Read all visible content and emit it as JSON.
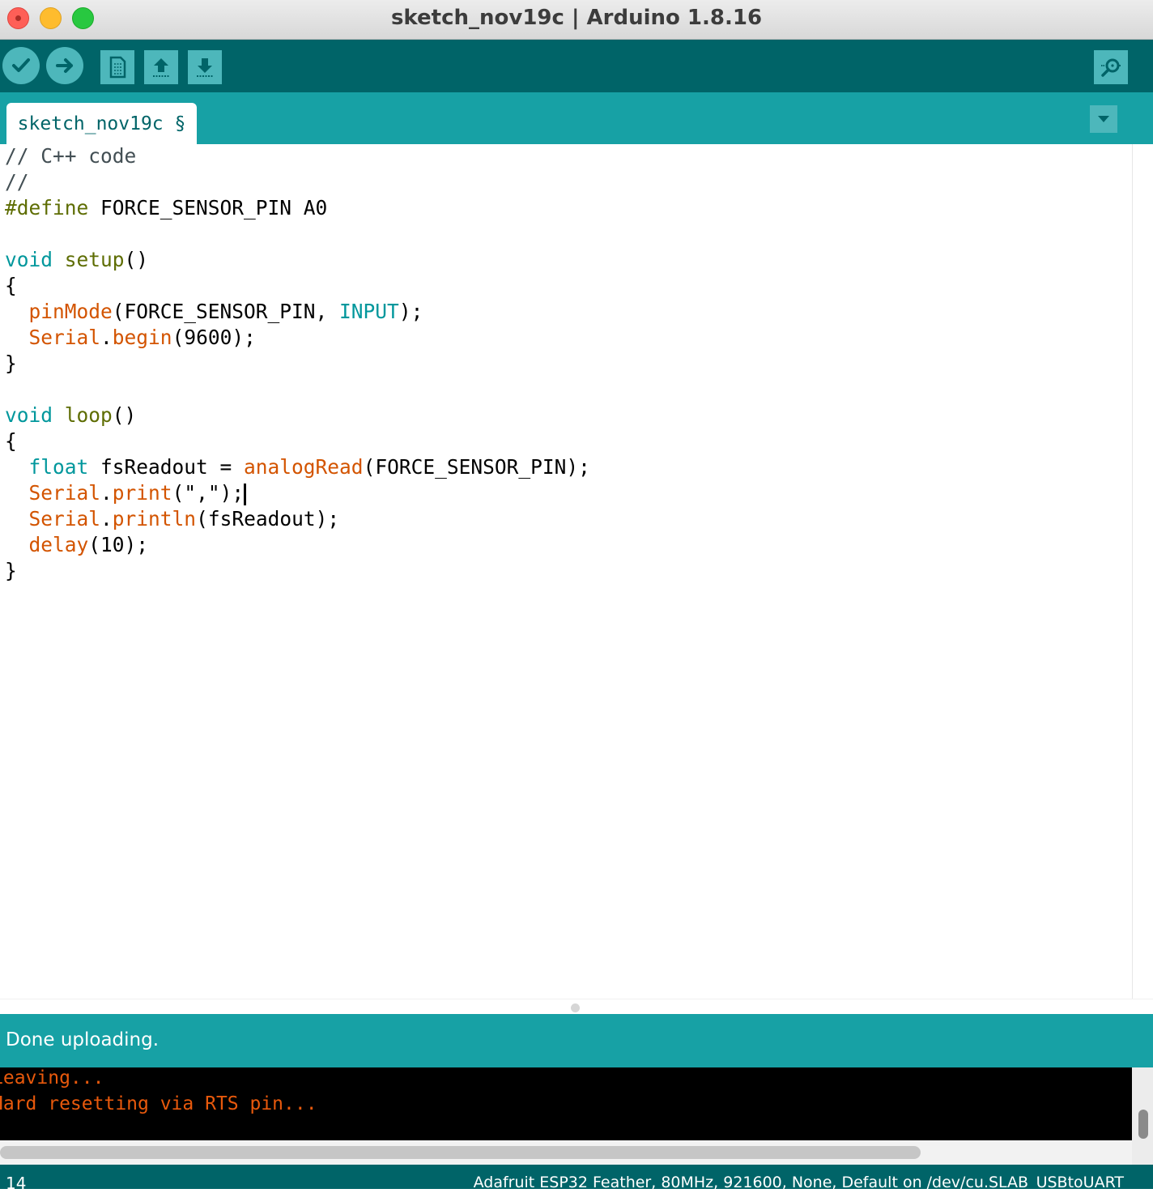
{
  "window": {
    "title": "sketch_nov19c | Arduino 1.8.16"
  },
  "toolbar": {
    "buttons": [
      {
        "name": "verify",
        "icon": "checkmark-icon"
      },
      {
        "name": "upload",
        "icon": "arrow-right-icon"
      },
      {
        "name": "new",
        "icon": "new-file-icon"
      },
      {
        "name": "open",
        "icon": "open-upload-icon"
      },
      {
        "name": "save",
        "icon": "save-download-icon"
      }
    ],
    "serial_monitor_icon": "serial-monitor-icon"
  },
  "tabs": [
    {
      "label": "sketch_nov19c §",
      "active": true
    }
  ],
  "editor": {
    "lines": [
      [
        {
          "t": "// C++ code",
          "c": "cm"
        }
      ],
      [
        {
          "t": "//",
          "c": "cm"
        }
      ],
      [
        {
          "t": "#define",
          "c": "pp"
        },
        {
          "t": " FORCE_SENSOR_PIN A0",
          "c": ""
        }
      ],
      [],
      [
        {
          "t": "void",
          "c": "kw"
        },
        {
          "t": " ",
          "c": ""
        },
        {
          "t": "setup",
          "c": "fn"
        },
        {
          "t": "()",
          "c": ""
        }
      ],
      [
        {
          "t": "{",
          "c": ""
        }
      ],
      [
        {
          "t": "  ",
          "c": ""
        },
        {
          "t": "pinMode",
          "c": "lf"
        },
        {
          "t": "(FORCE_SENSOR_PIN, ",
          "c": ""
        },
        {
          "t": "INPUT",
          "c": "ct"
        },
        {
          "t": ");",
          "c": ""
        }
      ],
      [
        {
          "t": "  ",
          "c": ""
        },
        {
          "t": "Serial",
          "c": "lf"
        },
        {
          "t": ".",
          "c": ""
        },
        {
          "t": "begin",
          "c": "lf"
        },
        {
          "t": "(9600);",
          "c": ""
        }
      ],
      [
        {
          "t": "}",
          "c": ""
        }
      ],
      [],
      [
        {
          "t": "void",
          "c": "kw"
        },
        {
          "t": " ",
          "c": ""
        },
        {
          "t": "loop",
          "c": "fn"
        },
        {
          "t": "()",
          "c": ""
        }
      ],
      [
        {
          "t": "{",
          "c": ""
        }
      ],
      [
        {
          "t": "  ",
          "c": ""
        },
        {
          "t": "float",
          "c": "kw"
        },
        {
          "t": " fsReadout = ",
          "c": ""
        },
        {
          "t": "analogRead",
          "c": "lf"
        },
        {
          "t": "(FORCE_SENSOR_PIN);",
          "c": ""
        }
      ],
      [
        {
          "t": "  ",
          "c": ""
        },
        {
          "t": "Serial",
          "c": "lf"
        },
        {
          "t": ".",
          "c": ""
        },
        {
          "t": "print",
          "c": "lf"
        },
        {
          "t": "(\",\");",
          "c": ""
        },
        {
          "t": "",
          "c": "caret"
        }
      ],
      [
        {
          "t": "  ",
          "c": ""
        },
        {
          "t": "Serial",
          "c": "lf"
        },
        {
          "t": ".",
          "c": ""
        },
        {
          "t": "println",
          "c": "lf"
        },
        {
          "t": "(fsReadout);",
          "c": ""
        }
      ],
      [
        {
          "t": "  ",
          "c": ""
        },
        {
          "t": "delay",
          "c": "lf"
        },
        {
          "t": "(10);",
          "c": ""
        }
      ],
      [
        {
          "t": "}",
          "c": ""
        }
      ]
    ]
  },
  "status": {
    "message": "Done uploading."
  },
  "console": {
    "lines": [
      "Leaving...",
      "Hard resetting via RTS pin..."
    ]
  },
  "bottom": {
    "line_number": "14",
    "board_info": "Adafruit ESP32 Feather, 80MHz, 921600, None, Default on /dev/cu.SLAB_USBtoUART"
  },
  "colors": {
    "toolbar_bg": "#006468",
    "tabstrip_bg": "#17a1a5",
    "button_bg": "#4db7bb",
    "console_text": "#e8590c"
  }
}
